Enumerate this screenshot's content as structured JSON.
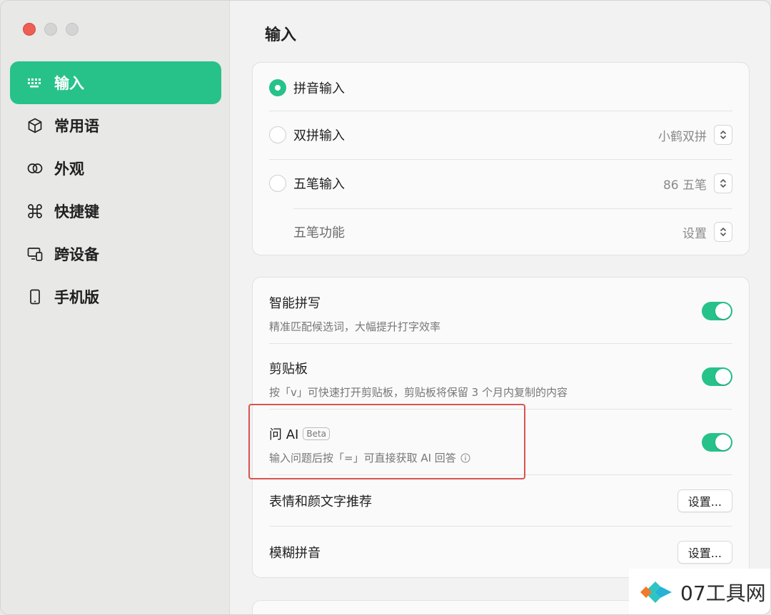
{
  "sidebar": {
    "items": [
      {
        "label": "输入",
        "icon": "keyboard-icon",
        "active": true
      },
      {
        "label": "常用语",
        "icon": "cube-icon",
        "active": false
      },
      {
        "label": "外观",
        "icon": "rings-icon",
        "active": false
      },
      {
        "label": "快捷键",
        "icon": "command-icon",
        "active": false
      },
      {
        "label": "跨设备",
        "icon": "devices-icon",
        "active": false
      },
      {
        "label": "手机版",
        "icon": "phone-icon",
        "active": false
      }
    ]
  },
  "main": {
    "title": "输入",
    "input_methods": {
      "pinyin": {
        "label": "拼音输入",
        "selected": true
      },
      "shuangpin": {
        "label": "双拼输入",
        "selected": false,
        "value": "小鹤双拼"
      },
      "wubi": {
        "label": "五笔输入",
        "selected": false,
        "value": "86 五笔"
      },
      "wubi_features": {
        "label": "五笔功能",
        "value": "设置"
      }
    },
    "options": {
      "smart_spell": {
        "title": "智能拼写",
        "desc": "精准匹配候选词，大幅提升打字效率",
        "enabled": true
      },
      "clipboard": {
        "title": "剪贴板",
        "desc": "按「v」可快速打开剪贴板，剪贴板将保留 3 个月内复制的内容",
        "enabled": true
      },
      "ask_ai": {
        "title": "问 AI",
        "badge": "Beta",
        "desc": "输入问题后按「=」可直接获取 AI 回答",
        "enabled": true
      },
      "emoji": {
        "title": "表情和颜文字推荐",
        "button": "设置..."
      },
      "fuzzy": {
        "title": "模糊拼音",
        "button": "设置..."
      }
    }
  },
  "watermark": {
    "text": "07工具网"
  },
  "colors": {
    "accent": "#27c28a",
    "highlight": "#d9534f",
    "close": "#ed5e55"
  }
}
